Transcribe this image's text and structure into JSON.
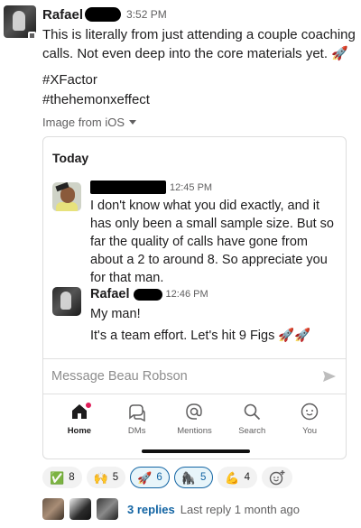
{
  "message": {
    "sender": "Rafael",
    "time": "3:52 PM",
    "text": "This is literally from just attending a couple coaching calls. Not even deep into the core materials yet. 🚀",
    "hashtags": [
      "#XFactor",
      "#thehemonxeffect"
    ],
    "image_source": "Image from iOS"
  },
  "screenshot": {
    "day_divider": "Today",
    "reply_time": "12:45 PM",
    "reply_text": "I don't know what you did exactly, and it has only been a small sample size. But so far the quality of calls have gone from about a 2 to around 8. So appreciate you for that man.",
    "rafael_name": "Rafael",
    "rafael_time": "12:46 PM",
    "rafael_line1": "My man!",
    "rafael_line2": "It's a team effort. Let's hit 9 Figs 🚀🚀",
    "compose_placeholder": "Message Beau Robson",
    "tabs": [
      {
        "label": "Home",
        "icon": "home-icon"
      },
      {
        "label": "DMs",
        "icon": "dms-icon"
      },
      {
        "label": "Mentions",
        "icon": "mentions-icon"
      },
      {
        "label": "Search",
        "icon": "search-icon"
      },
      {
        "label": "You",
        "icon": "you-icon"
      }
    ]
  },
  "reactions": [
    {
      "emoji": "✅",
      "count": "8"
    },
    {
      "emoji": "🙌",
      "count": "5"
    },
    {
      "emoji": "🚀",
      "count": "6"
    },
    {
      "emoji": "🦍",
      "count": "5"
    },
    {
      "emoji": "💪",
      "count": "4"
    }
  ],
  "add_reaction_icon": "add-emoji-icon",
  "thread": {
    "replies": "3 replies",
    "last_reply": "Last reply 1 month ago"
  },
  "colors": {
    "link": "#1264a3",
    "badge": "#e01e5a"
  }
}
